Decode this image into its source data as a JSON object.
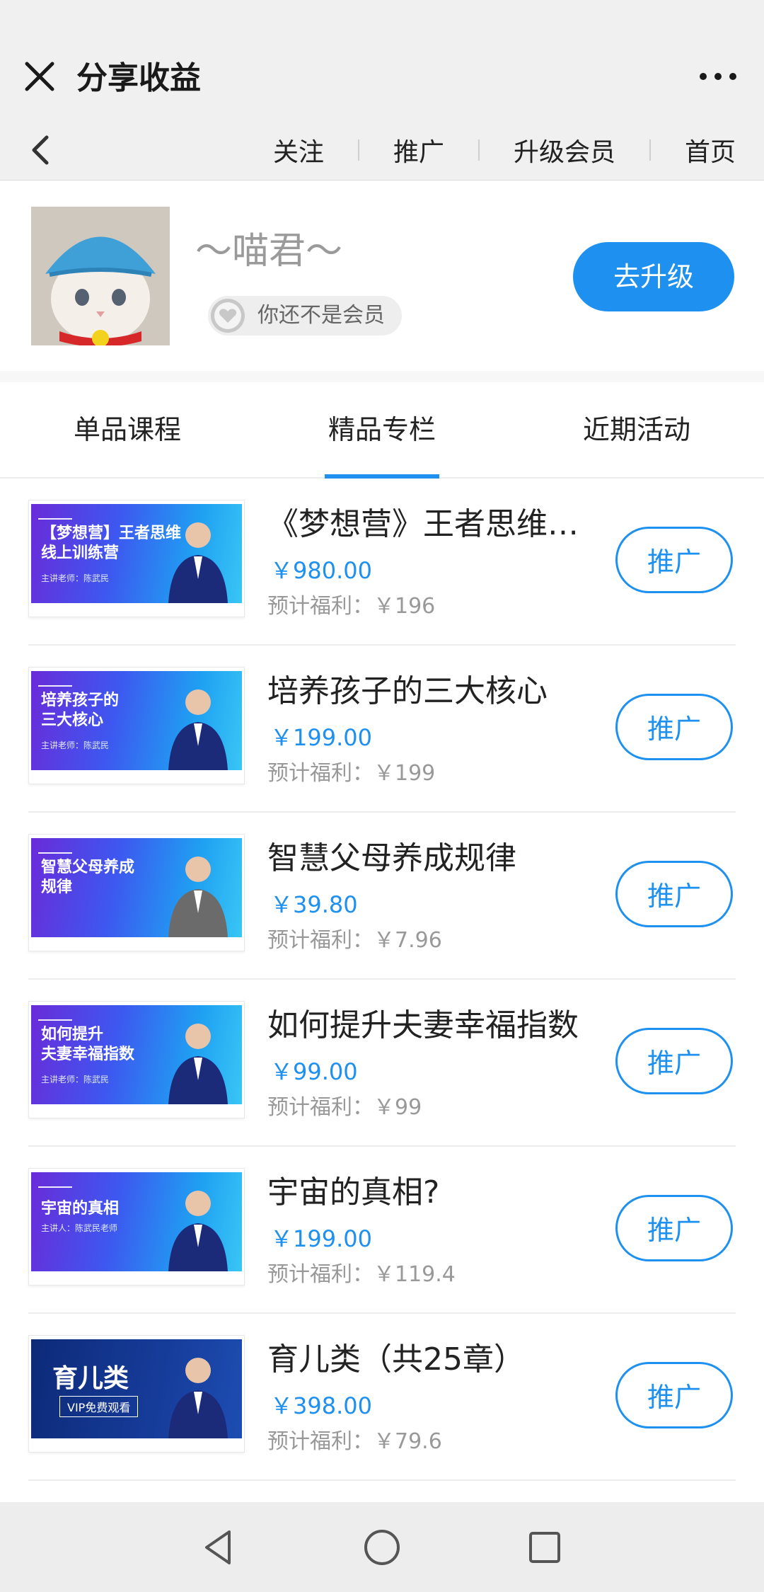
{
  "title_bar": {
    "title": "分享收益"
  },
  "nav_links": [
    "关注",
    "推广",
    "升级会员",
    "首页"
  ],
  "profile": {
    "username": "～喵君～",
    "member_status": "你还不是会员",
    "upgrade_label": "去升级"
  },
  "tabs": [
    {
      "label": "单品课程",
      "selected": false
    },
    {
      "label": "精品专栏",
      "selected": true
    },
    {
      "label": "近期活动",
      "selected": false
    }
  ],
  "items": [
    {
      "name": "《梦想营》王者思维训练营",
      "price": "￥980.00",
      "welfare": "预计福利：￥196",
      "button": "推广",
      "thumb": {
        "line1": "【梦想营】王者思维",
        "line2": "线上训练营",
        "sub": "主讲老师：陈武民"
      }
    },
    {
      "name": "培养孩子的三大核心",
      "price": "￥199.00",
      "welfare": "预计福利：￥199",
      "button": "推广",
      "thumb": {
        "line1": "培养孩子的",
        "line2": "三大核心",
        "sub": "主讲老师：陈武民"
      }
    },
    {
      "name": "智慧父母养成规律",
      "price": "￥39.80",
      "welfare": "预计福利：￥7.96",
      "button": "推广",
      "thumb": {
        "line1": "智慧父母养成",
        "line2": "规律",
        "sub": ""
      }
    },
    {
      "name": "如何提升夫妻幸福指数",
      "price": "￥99.00",
      "welfare": "预计福利：￥99",
      "button": "推广",
      "thumb": {
        "line1": "如何提升",
        "line2": "夫妻幸福指数",
        "sub": "主讲老师：陈武民"
      }
    },
    {
      "name": "宇宙的真相?",
      "price": "￥199.00",
      "welfare": "预计福利：￥119.4",
      "button": "推广",
      "thumb": {
        "line1": "宇宙的真相",
        "line2": "",
        "sub": "主讲人：陈武民老师"
      }
    },
    {
      "name": "育儿类（共25章）",
      "price": "￥398.00",
      "welfare": "预计福利：￥79.6",
      "button": "推广",
      "thumb": {
        "line1": "育儿类",
        "line2": "VIP免费观看",
        "sub": ""
      }
    }
  ],
  "colors": {
    "accent": "#1e90ef",
    "bar_bg": "#f0f0f0"
  },
  "icons": [
    "close-icon",
    "more-icon",
    "back-chevron-icon",
    "heart-icon",
    "back-triangle-icon",
    "home-circle-icon",
    "recents-square-icon"
  ]
}
